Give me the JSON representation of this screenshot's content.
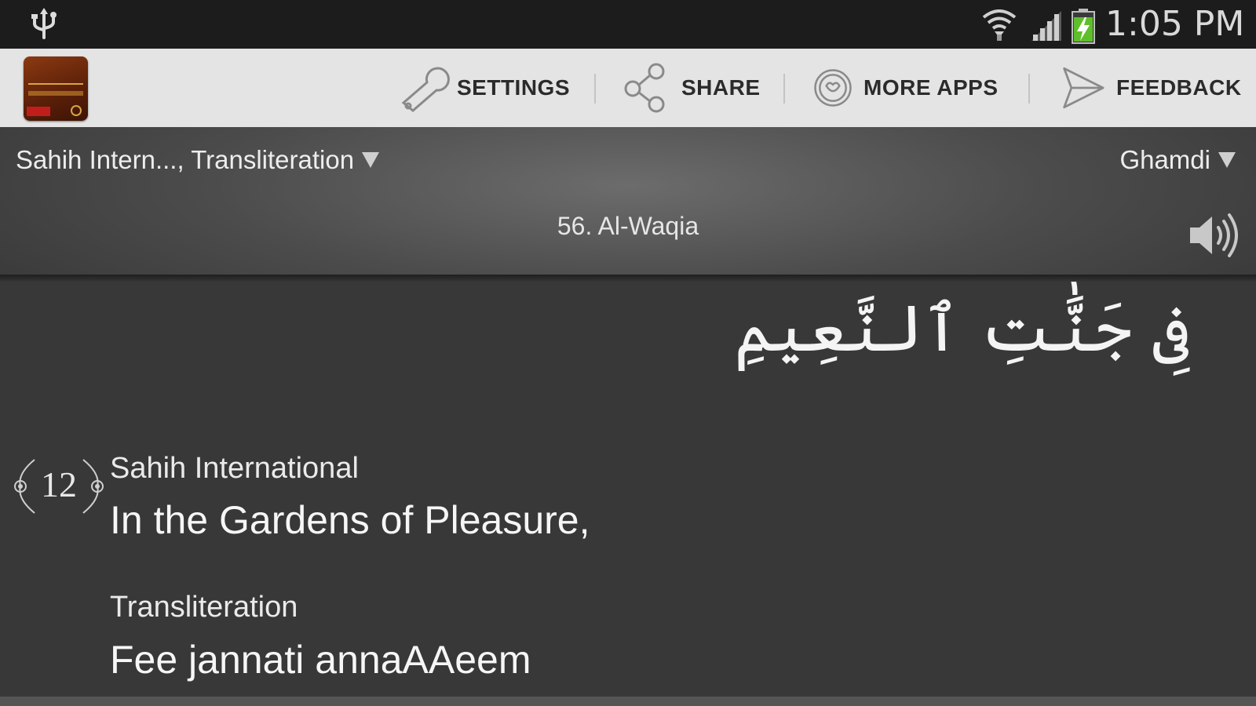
{
  "status_bar": {
    "time": "1:05 PM",
    "icons": [
      "usb-icon",
      "wifi-icon",
      "signal-icon",
      "battery-charging-icon"
    ]
  },
  "action_bar": {
    "app_icon": "app-logo-icon",
    "actions": [
      {
        "label": "SETTINGS",
        "icon": "wrench-icon"
      },
      {
        "label": "SHARE",
        "icon": "share-icon"
      },
      {
        "label": "MORE APPS",
        "icon": "heart-circle-icon"
      },
      {
        "label": "FEEDBACK",
        "icon": "send-icon"
      }
    ]
  },
  "header": {
    "translation_select": "Sahih Intern..., Transliteration",
    "reciter_select": "Ghamdi",
    "surah_title": "56. Al-Waqia",
    "audio_icon": "speaker-icon"
  },
  "verse": {
    "number": "12",
    "arabic": "فِى جَنَّٰتِ ٱلنَّعِيمِ",
    "translations": [
      {
        "source": "Sahih International",
        "text": "In the Gardens of Pleasure,"
      },
      {
        "source": "Transliteration",
        "text": "Fee jannati annaAAeem"
      }
    ]
  }
}
